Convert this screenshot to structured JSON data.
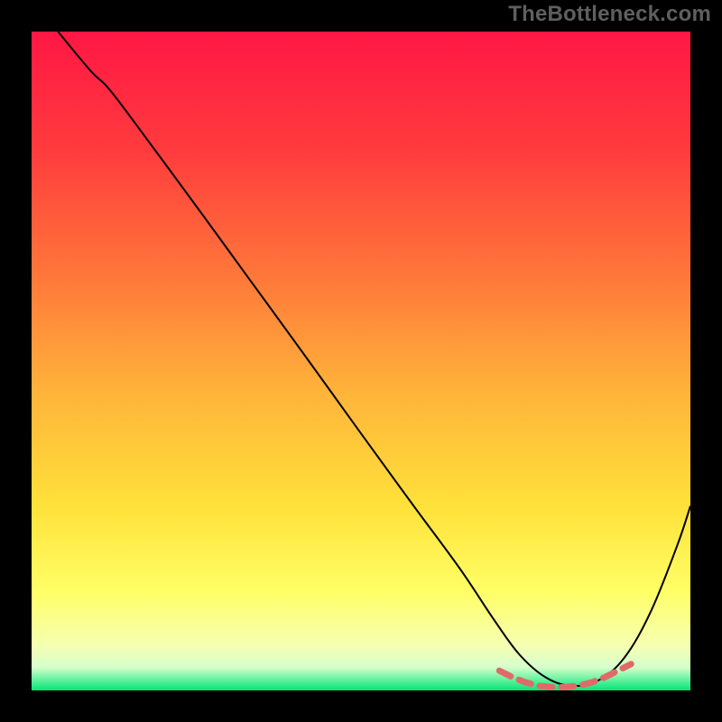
{
  "watermark": "TheBottleneck.com",
  "chart_data": {
    "type": "line",
    "title": "",
    "xlabel": "",
    "ylabel": "",
    "xlim": [
      0,
      100
    ],
    "ylim": [
      0,
      100
    ],
    "grid": false,
    "background_gradient": {
      "stops": [
        {
          "offset": 0.0,
          "color": "#ff1744"
        },
        {
          "offset": 0.18,
          "color": "#ff3b3d"
        },
        {
          "offset": 0.38,
          "color": "#ff7a3a"
        },
        {
          "offset": 0.55,
          "color": "#ffb43a"
        },
        {
          "offset": 0.72,
          "color": "#ffe13a"
        },
        {
          "offset": 0.85,
          "color": "#ffff66"
        },
        {
          "offset": 0.93,
          "color": "#f6ffb0"
        },
        {
          "offset": 0.965,
          "color": "#d6ffcc"
        },
        {
          "offset": 1.0,
          "color": "#00e676"
        }
      ]
    },
    "series": [
      {
        "name": "bottleneck-curve",
        "color": "#000000",
        "width": 2,
        "x": [
          4,
          9,
          12,
          18,
          25,
          33,
          41,
          50,
          58,
          65,
          70,
          74,
          78,
          82,
          86,
          90,
          94,
          98,
          100
        ],
        "y": [
          100,
          94,
          91,
          83,
          73.5,
          62.5,
          51.5,
          39,
          28,
          18.5,
          11,
          5.5,
          2,
          0.7,
          1.5,
          5,
          12,
          22,
          28
        ]
      },
      {
        "name": "optimal-zone-marker",
        "color": "#e06a6a",
        "type": "dashed-band",
        "x": [
          71,
          73,
          75,
          77,
          79,
          81,
          83,
          85,
          87,
          89,
          91
        ],
        "y": [
          3.0,
          2.0,
          1.2,
          0.7,
          0.5,
          0.5,
          0.7,
          1.2,
          2.0,
          3.0,
          4.0
        ]
      }
    ]
  }
}
